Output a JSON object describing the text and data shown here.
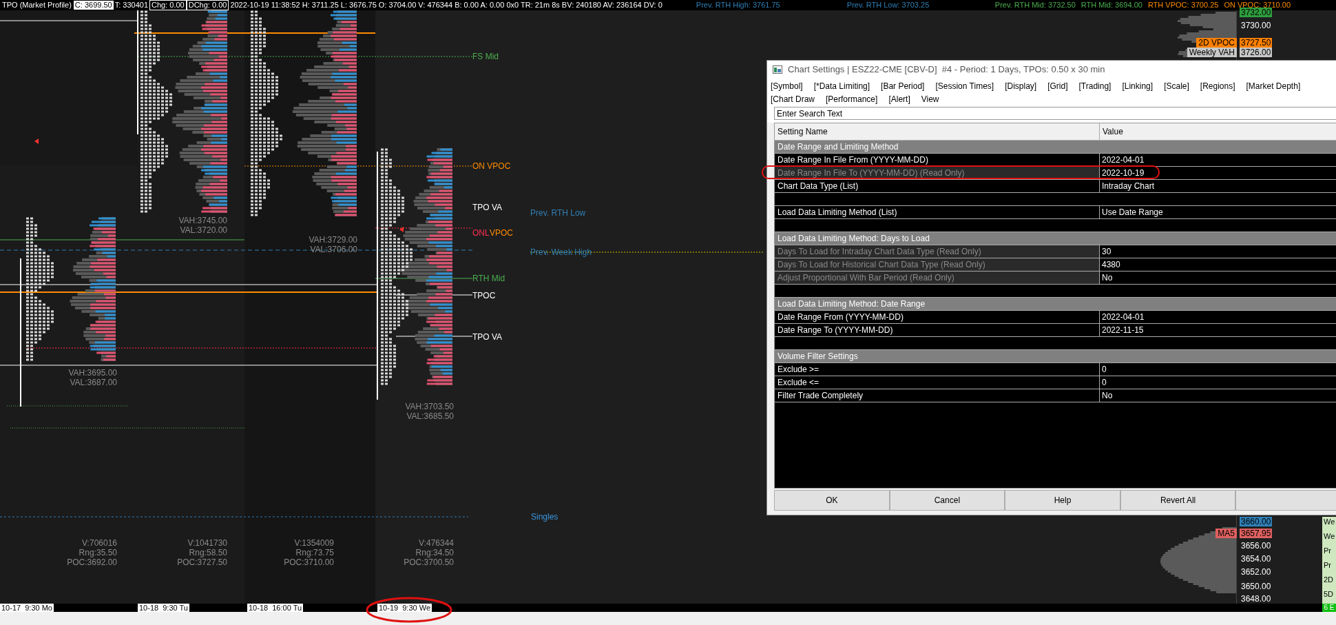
{
  "status_bar": {
    "title": "TPO (Market Profile)",
    "fields": [
      {
        "text": "C: 3699.50",
        "kind": "filled"
      },
      {
        "text": "T: 330401",
        "kind": "plain"
      },
      {
        "text": "Chg: 0.00",
        "kind": "outlined"
      },
      {
        "text": "DChg: 0.00",
        "kind": "outlined"
      },
      {
        "text": "2022-10-19 11:38:52 H: 3711.25 L: 3676.75 O: 3704.00 V: 476344 B: 0.00 A: 0.00 0x0 TR: 21m 8s BV: 240180 AV: 236164 DV: 0",
        "kind": "plain"
      }
    ]
  },
  "header_labels": [
    {
      "text": "Prev. RTH High: 3761.75",
      "color": "#2f7fb5"
    },
    {
      "text": "Prev. RTH Low: 3703.25",
      "color": "#2f7fb5"
    },
    {
      "text": "Prev. RTH Mid: 3732.50",
      "color": "#4caf50"
    },
    {
      "text": "RTH Mid: 3694.00",
      "color": "#4caf50"
    },
    {
      "text": "RTH VPOC: 3700.25",
      "color": "#ff8c00"
    },
    {
      "text": "ON VPOC: 3710.00",
      "color": "#ff8c00"
    }
  ],
  "chart_labels": [
    {
      "text": "FS Mid",
      "color": "#4caf50"
    },
    {
      "text": "ON VPOC",
      "color": "#ff8c00"
    },
    {
      "text": "TPO VA",
      "color": "#ffffff"
    },
    {
      "text": "Prev. RTH Low",
      "color": "#2f7fb5"
    },
    {
      "text": "ONL",
      "color": "#ff3050"
    },
    {
      "text": "VPOC",
      "color": "#ff8c00"
    },
    {
      "text": "Prev. Week High",
      "color": "#2f7fb5"
    },
    {
      "text": "RTH Mid",
      "color": "#4caf50"
    },
    {
      "text": "TPOC",
      "color": "#ffffff"
    },
    {
      "text": "TPO VA",
      "color": "#ffffff"
    },
    {
      "text": "Singles",
      "color": "#3a95e0"
    }
  ],
  "value_areas": [
    {
      "vah": "VAH:3695.00",
      "val": "VAL:3687.00"
    },
    {
      "vah": "VAH:3745.00",
      "val": "VAL:3720.00"
    },
    {
      "vah": "VAH:3729.00",
      "val": "VAL:3706.00"
    },
    {
      "vah": "VAH:3703.50",
      "val": "VAL:3685.50"
    }
  ],
  "session_stats": [
    {
      "volume": "V:706016",
      "range": "Rng:35.50",
      "poc": "POC:3692.00"
    },
    {
      "volume": "V:1041730",
      "range": "Rng:58.50",
      "poc": "POC:3727.50"
    },
    {
      "volume": "V:1354009",
      "range": "Rng:73.75",
      "poc": "POC:3710.00"
    },
    {
      "volume": "V:476344",
      "range": "Rng:34.50",
      "poc": "POC:3700.50"
    }
  ],
  "time_axis": [
    "10-17  9:30 Mo",
    "10-18  9:30 Tu",
    "10-18  16:00 Tu",
    "10-19  9:30 We"
  ],
  "price_axis": [
    {
      "price": "3732.00",
      "color": "#2e9e3e"
    },
    {
      "price": "3730.00"
    },
    {
      "price": "3727.50",
      "color": "#ff8000",
      "tag": {
        "text": "2D VPOC",
        "color": "#ff8000"
      }
    },
    {
      "price": "3726.00",
      "color": "#c8c8c8",
      "tag": {
        "text": "Weekly VAH",
        "color": "#c8c8c8"
      }
    },
    {
      "price": "3660.00",
      "color": "#2f7fb5"
    },
    {
      "price": "3657.95",
      "color": "#e06060",
      "tag": {
        "text": "MA5",
        "color": "#e06060"
      }
    },
    {
      "price": "3656.00"
    },
    {
      "price": "3654.00"
    },
    {
      "price": "3652.00"
    },
    {
      "price": "3650.00"
    },
    {
      "price": "3648.00"
    }
  ],
  "side_panel": {
    "items": [
      "We",
      "We",
      "Pr",
      "Pr",
      "2D",
      "5D"
    ],
    "badge": "6 E"
  },
  "dialog": {
    "title": "Chart Settings | ESZ22-CME [CBV-D]  #4 - Period: 1 Days, TPOs: 0.50 x 30 min",
    "menu": [
      "[Symbol]",
      "[*Data Limiting]",
      "[Bar Period]",
      "[Session Times]",
      "[Display]",
      "[Grid]",
      "[Trading]",
      "[Linking]",
      "[Scale]",
      "[Regions]",
      "[Market Depth]",
      "[Chart Draw",
      "[Performance]",
      "[Alert]",
      "View"
    ],
    "search": {
      "placeholder": "Enter Search Text"
    },
    "columns": [
      "Setting Name",
      "Value"
    ],
    "rows": [
      {
        "kind": "group",
        "name": "Date Range and Limiting Method"
      },
      {
        "kind": "setting",
        "name": "Date Range In File From (YYYY-MM-DD)",
        "value": "2022-04-01",
        "read_only": false
      },
      {
        "kind": "setting",
        "name": "Date Range In File To (YYYY-MM-DD) (Read Only)",
        "value": "2022-10-19",
        "read_only": true
      },
      {
        "kind": "setting",
        "name": "Chart Data Type (List)",
        "value": "Intraday Chart",
        "read_only": false
      },
      {
        "kind": "blank"
      },
      {
        "kind": "setting",
        "name": "Load Data Limiting Method (List)",
        "value": "Use Date Range",
        "read_only": false
      },
      {
        "kind": "blank"
      },
      {
        "kind": "group",
        "name": "Load Data Limiting Method: Days to Load"
      },
      {
        "kind": "setting",
        "name": "Days To Load for Intraday Chart Data Type (Read Only)",
        "value": "30",
        "read_only": true
      },
      {
        "kind": "setting",
        "name": "Days To Load for Historical Chart Data Type (Read Only)",
        "value": "4380",
        "read_only": true
      },
      {
        "kind": "setting",
        "name": "Adjust Proportional With Bar Period (Read Only)",
        "value": "No",
        "read_only": true
      },
      {
        "kind": "blank"
      },
      {
        "kind": "group",
        "name": "Load Data Limiting Method: Date Range"
      },
      {
        "kind": "setting",
        "name": "Date Range From (YYYY-MM-DD)",
        "value": "2022-04-01",
        "read_only": false
      },
      {
        "kind": "setting",
        "name": "Date Range To (YYYY-MM-DD)",
        "value": "2022-11-15",
        "read_only": false
      },
      {
        "kind": "blank"
      },
      {
        "kind": "group",
        "name": "Volume Filter Settings"
      },
      {
        "kind": "setting",
        "name": "Exclude >=",
        "value": "0",
        "read_only": false
      },
      {
        "kind": "setting",
        "name": "Exclude <=",
        "value": "0",
        "read_only": false
      },
      {
        "kind": "setting",
        "name": "Filter Trade Completely",
        "value": "No",
        "read_only": false
      }
    ],
    "buttons": [
      "OK",
      "Cancel",
      "Help",
      "Revert All"
    ]
  }
}
